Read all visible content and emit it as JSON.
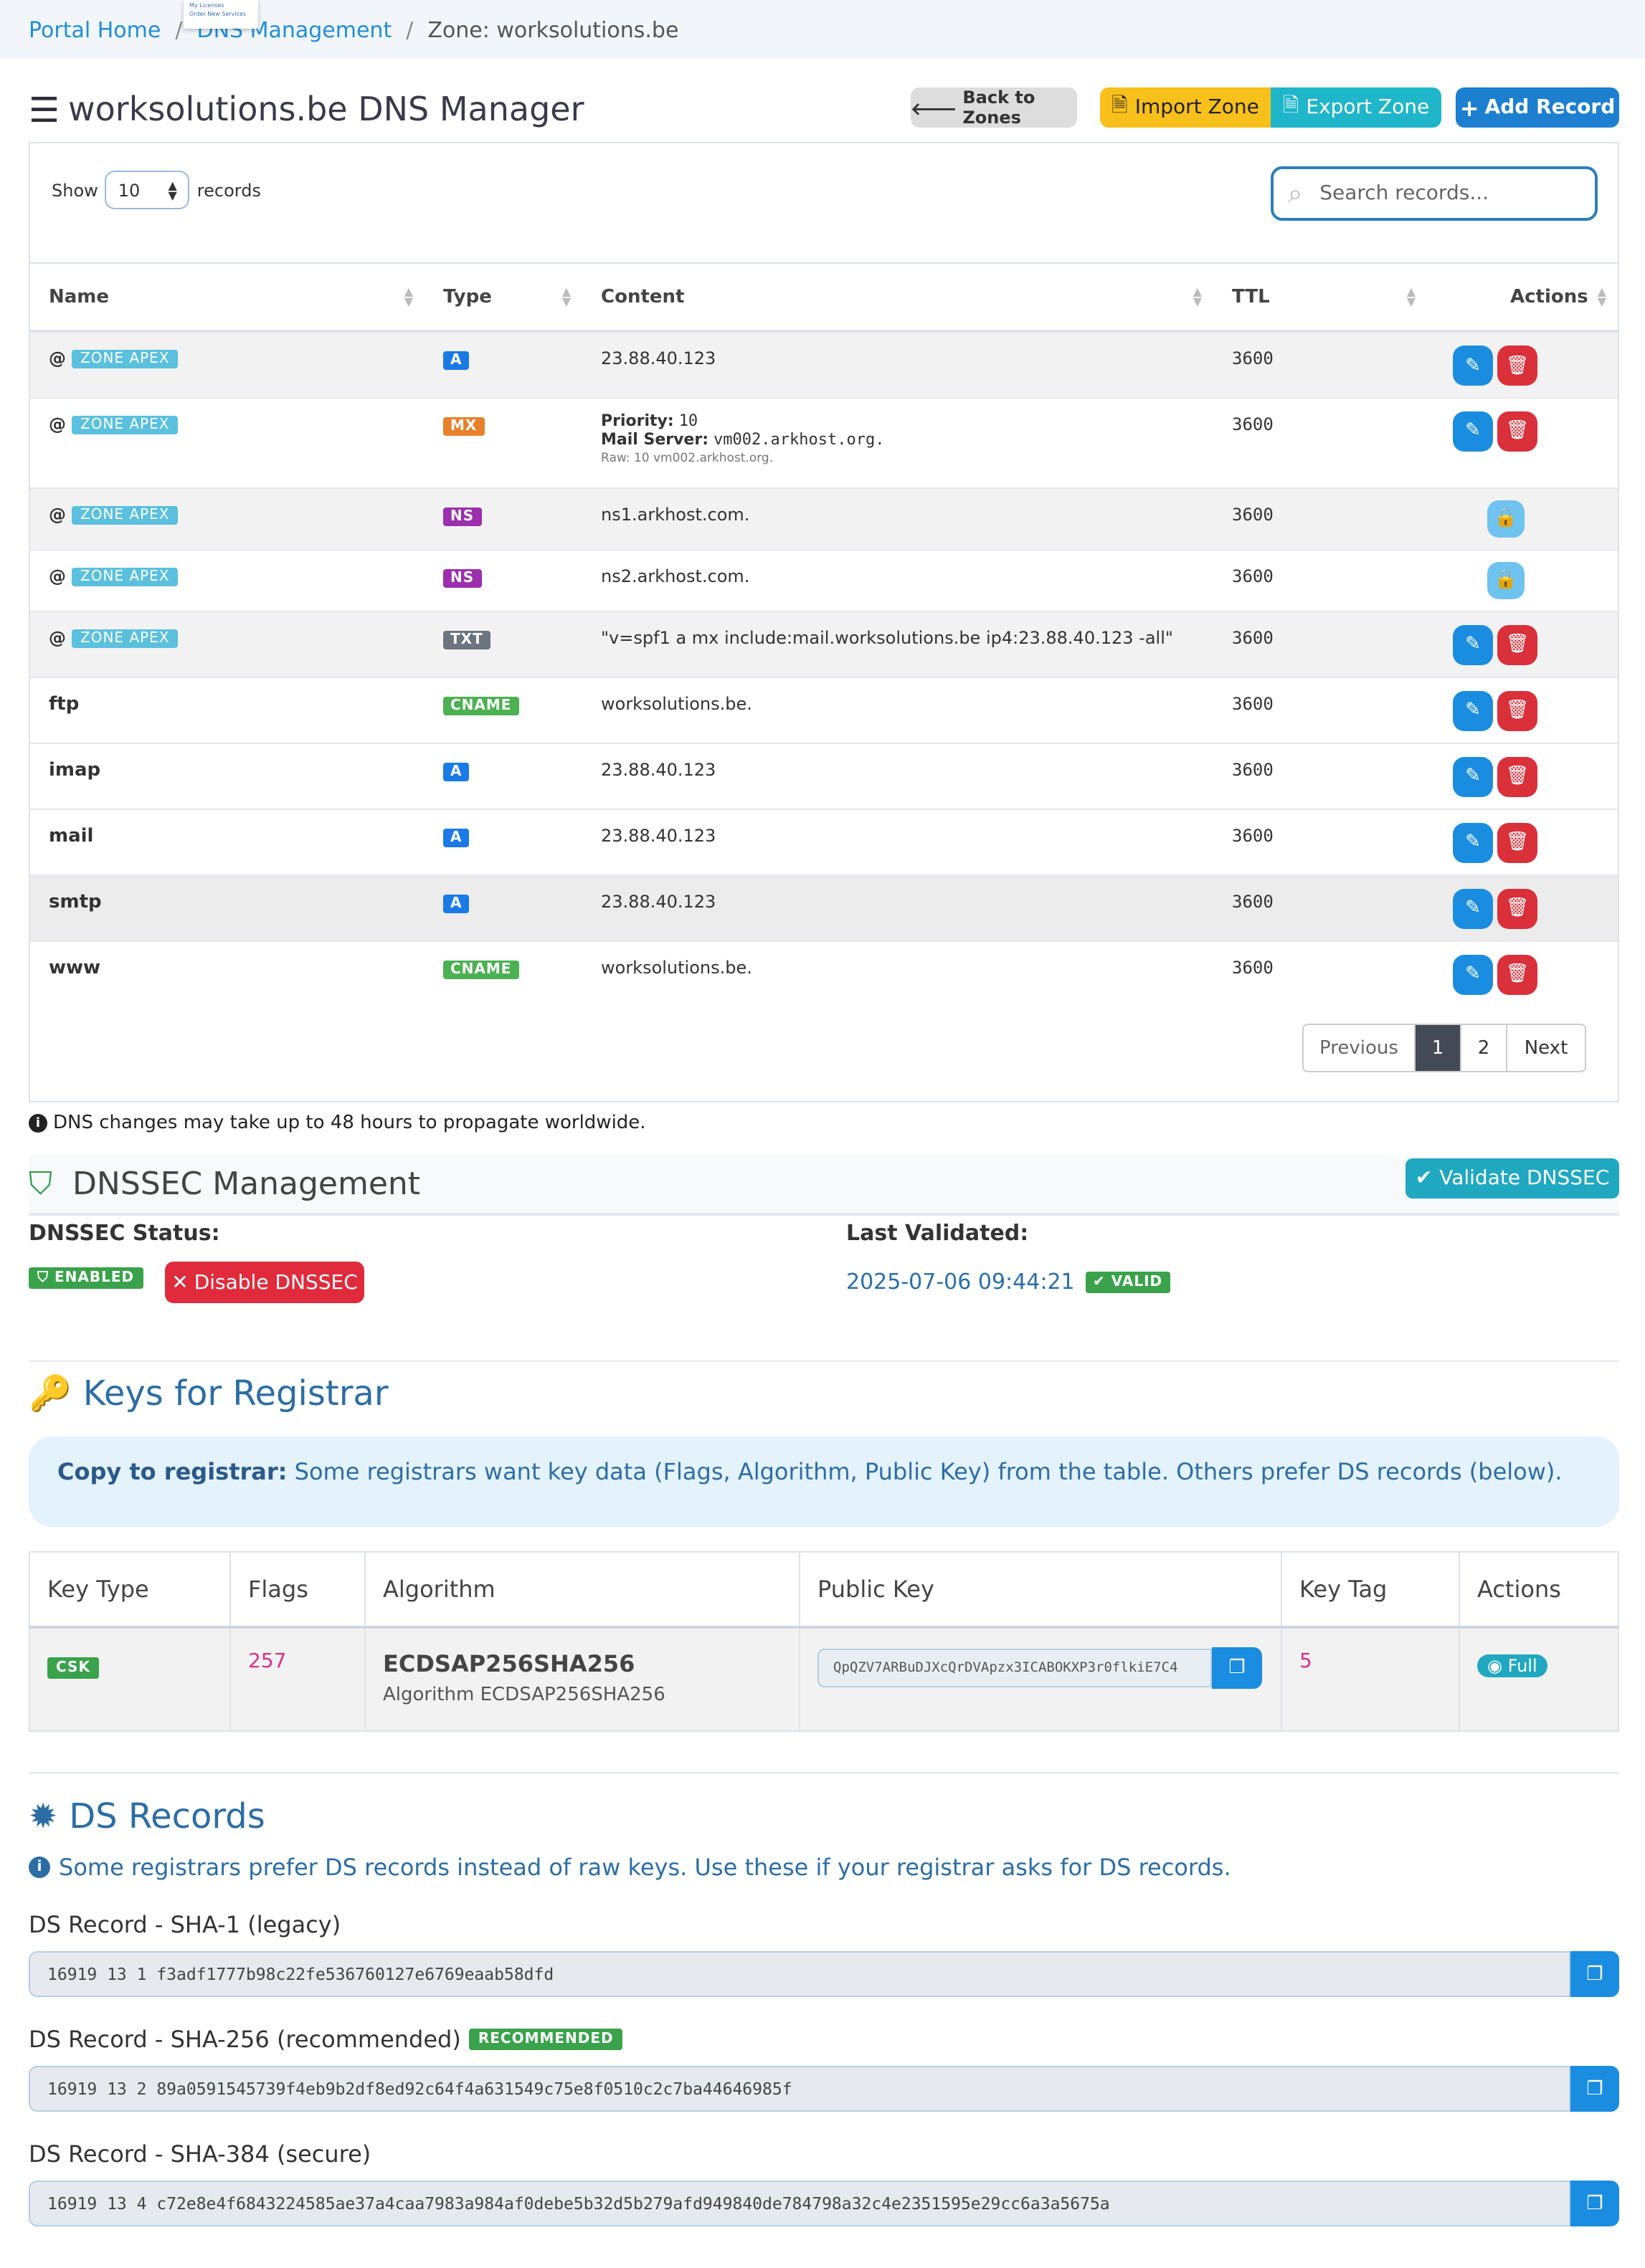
{
  "breadcrumb": {
    "home": "Portal Home",
    "section": "DNS Management",
    "current": "Zone: worksolutions.be",
    "menu_item_1": "My Licenses",
    "menu_item_2": "Order New Services"
  },
  "header": {
    "title": "worksolutions.be DNS Manager",
    "back": "Back to Zones",
    "import": "Import Zone",
    "export": "Export Zone",
    "add": "Add Record"
  },
  "controls": {
    "show_label": "Show",
    "show_value": "10",
    "records_label": "records",
    "search_placeholder": "Search records..."
  },
  "table": {
    "headers": [
      "Name",
      "Type",
      "Content",
      "TTL",
      "Actions"
    ],
    "apex_label": "ZONE APEX",
    "rows": [
      {
        "name": "@",
        "apex": true,
        "type": "A",
        "content": "23.88.40.123",
        "ttl": "3600",
        "editable": true
      },
      {
        "name": "@",
        "apex": true,
        "type": "MX",
        "priority_label": "Priority:",
        "priority": "10",
        "server_label": "Mail Server:",
        "server": "vm002.arkhost.org.",
        "raw": "Raw: 10 vm002.arkhost.org.",
        "ttl": "3600",
        "editable": true
      },
      {
        "name": "@",
        "apex": true,
        "type": "NS",
        "content": "ns1.arkhost.com.",
        "ttl": "3600",
        "editable": false
      },
      {
        "name": "@",
        "apex": true,
        "type": "NS",
        "content": "ns2.arkhost.com.",
        "ttl": "3600",
        "editable": false
      },
      {
        "name": "@",
        "apex": true,
        "type": "TXT",
        "content": "\"v=spf1 a mx include:mail.worksolutions.be ip4:23.88.40.123 -all\"",
        "ttl": "3600",
        "editable": true
      },
      {
        "name": "ftp",
        "apex": false,
        "type": "CNAME",
        "content": "worksolutions.be.",
        "ttl": "3600",
        "editable": true
      },
      {
        "name": "imap",
        "apex": false,
        "type": "A",
        "content": "23.88.40.123",
        "ttl": "3600",
        "editable": true
      },
      {
        "name": "mail",
        "apex": false,
        "type": "A",
        "content": "23.88.40.123",
        "ttl": "3600",
        "editable": true
      },
      {
        "name": "smtp",
        "apex": false,
        "type": "A",
        "content": "23.88.40.123",
        "ttl": "3600",
        "editable": true
      },
      {
        "name": "www",
        "apex": false,
        "type": "CNAME",
        "content": "worksolutions.be.",
        "ttl": "3600",
        "editable": true
      }
    ]
  },
  "pagination": {
    "previous": "Previous",
    "page1": "1",
    "page2": "2",
    "next": "Next"
  },
  "note": "DNS changes may take up to 48 hours to propagate worldwide.",
  "dnssec": {
    "title": "DNSSEC Management",
    "validate": "Validate DNSSEC",
    "status_label": "DNSSEC Status:",
    "status_badge": "ENABLED",
    "disable": "Disable DNSSEC",
    "validated_label": "Last Validated:",
    "validated_value": "2025-07-06 09:44:21",
    "valid_badge": "VALID"
  },
  "keys": {
    "title": "Keys for Registrar",
    "callout_bold": "Copy to registrar:",
    "callout_text": " Some registrars want key data (Flags, Algorithm, Public Key) from the table. Others prefer DS records (below).",
    "headers": [
      "Key Type",
      "Flags",
      "Algorithm",
      "Public Key",
      "Key Tag",
      "Actions"
    ],
    "row": {
      "key_type": "CSK",
      "flags": "257",
      "algorithm": "ECDSAP256SHA256",
      "algorithm_sub": "Algorithm ECDSAP256SHA256",
      "public_key": "QpQZV7ARBuDJXcQrDVApzx3ICABOKXP3r0flkiE7C4",
      "key_tag": "5",
      "action": "Full"
    }
  },
  "ds": {
    "title": "DS Records",
    "info": "Some registrars prefer DS records instead of raw keys. Use these if your registrar asks for DS records.",
    "sha1_label": "DS Record - SHA-1 (legacy)",
    "sha1_value": "16919 13 1 f3adf1777b98c22fe536760127e6769eaab58dfd",
    "sha256_label": "DS Record - SHA-256 (recommended)",
    "sha256_badge": "RECOMMENDED",
    "sha256_value": "16919 13 2 89a0591545739f4eb9b2df8ed92c64f4a631549c75e8f0510c2c7ba44646985f",
    "sha384_label": "DS Record - SHA-384 (secure)",
    "sha384_value": "16919 13 4 c72e8e4f6843224585ae37a4caa7983a984af0debe5b32d5b279afd949840de784798a32c4e2351595e29cc6a3a5675a"
  }
}
